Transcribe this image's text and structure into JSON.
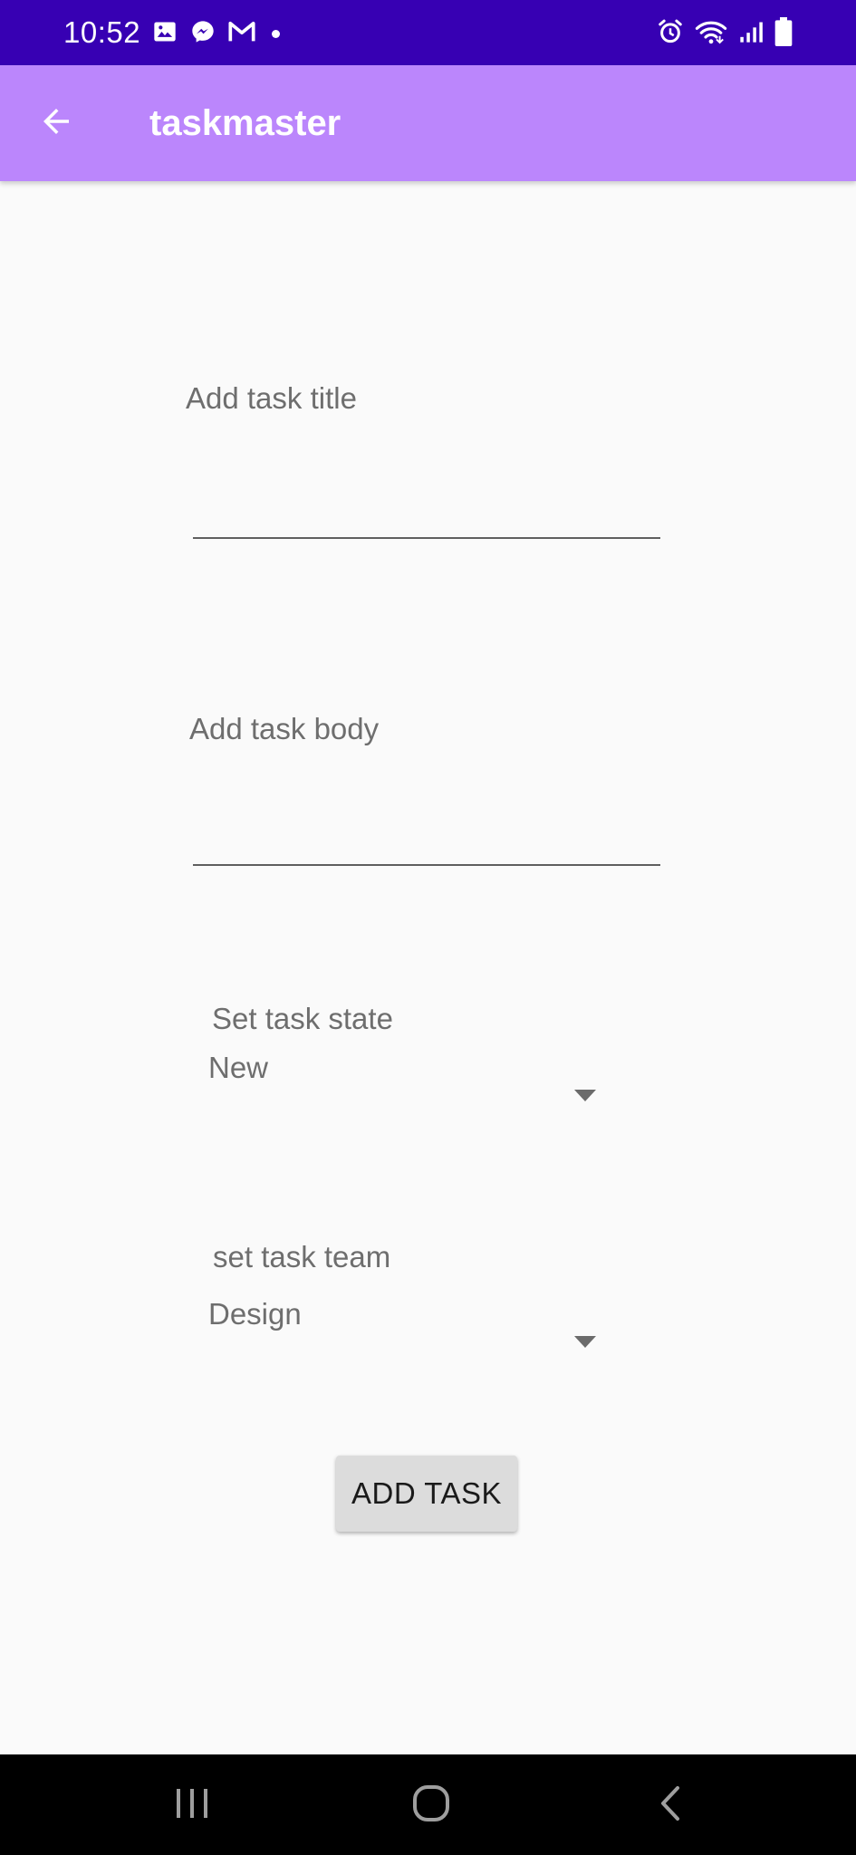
{
  "status_bar": {
    "time": "10:52",
    "left_icons": [
      "image-icon",
      "messenger-icon",
      "gmail-icon",
      "notification-dot"
    ],
    "right_icons": [
      "alarm-icon",
      "wifi-icon",
      "signal-icon",
      "battery-icon"
    ],
    "background": "#3700b3"
  },
  "app_bar": {
    "title": "taskmaster",
    "back_icon": "arrow-back-icon",
    "background": "#bb86fc"
  },
  "form": {
    "title_label": "Add task title",
    "title_value": "",
    "body_label": "Add task body",
    "body_value": "",
    "state_label": "Set task state",
    "state_selected": "New",
    "team_label": "set task team",
    "team_selected": "Design",
    "submit_label": "ADD TASK"
  },
  "nav_bar": {
    "buttons": [
      "recent-apps-icon",
      "home-icon",
      "back-icon"
    ]
  }
}
